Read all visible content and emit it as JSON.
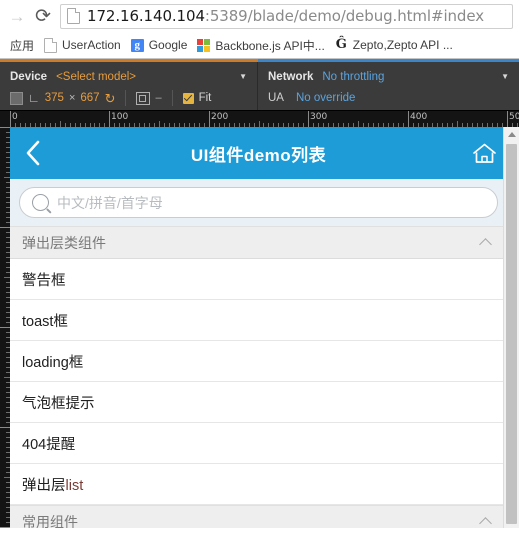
{
  "browser": {
    "nav": {
      "forward_icon": "arrow-right-icon",
      "reload_icon": "reload-icon"
    },
    "omnibox": {
      "page_icon": "page-icon",
      "url_host": "172.16.140.104",
      "url_path": ":5389/blade/demo/debug.html#index"
    },
    "bookmarks": {
      "apps_label": "应用",
      "items": [
        {
          "label": "UserAction",
          "icon": "page-icon"
        },
        {
          "label": "Google",
          "icon": "google-icon"
        },
        {
          "label": "Backbone.js API中...",
          "icon": "windows-icon"
        },
        {
          "label": "Zepto,Zepto API ...",
          "icon": "zepto-icon"
        }
      ]
    }
  },
  "devtools": {
    "device": {
      "label": "Device",
      "model": "<Select model>",
      "caret_icon": "chevron-down-icon",
      "chip_icon": "device-icon",
      "rotate_icon": "rotate-icon",
      "width": "375",
      "times": "×",
      "height": "667",
      "refresh_icon": "circular-arrow-icon",
      "screencast_icon": "screencast-icon",
      "minus": "–",
      "fit_checked": true,
      "fit_label": "Fit"
    },
    "network": {
      "label": "Network",
      "throttling": "No throttling",
      "caret_icon": "chevron-down-icon",
      "ua_label": "UA",
      "ua_value": "No override"
    },
    "ruler_h": {
      "labels": [
        "0",
        "100",
        "200",
        "300",
        "400",
        "50"
      ],
      "positions": [
        0,
        100,
        200,
        300,
        400,
        500
      ]
    }
  },
  "mobile": {
    "header": {
      "back_icon": "chevron-left-icon",
      "title": "UI组件demo列表",
      "home_icon": "home-icon"
    },
    "search": {
      "icon": "search-icon",
      "placeholder": "中文/拼音/首字母",
      "value": ""
    },
    "sections": [
      {
        "title": "弹出层类组件",
        "collapse_icon": "chevron-up-icon",
        "items": [
          {
            "label": "警告框"
          },
          {
            "label": "toast框"
          },
          {
            "label": "loading框"
          },
          {
            "label": "气泡框提示"
          },
          {
            "label": "404提醒"
          },
          {
            "label_prefix": "弹出层",
            "label_accent": "list"
          }
        ]
      },
      {
        "title": "常用组件",
        "collapse_icon": "chevron-up-icon",
        "items": []
      }
    ],
    "scrollbar": {
      "up_arrow_icon": "scroll-up-icon"
    }
  },
  "colors": {
    "brand_blue": "#1d9cd8",
    "devtools_bg": "#3b3b3b",
    "accent_orange": "#e89c3c",
    "accent_blue": "#5aa4e0",
    "fit_yellow": "#e5b53f"
  }
}
